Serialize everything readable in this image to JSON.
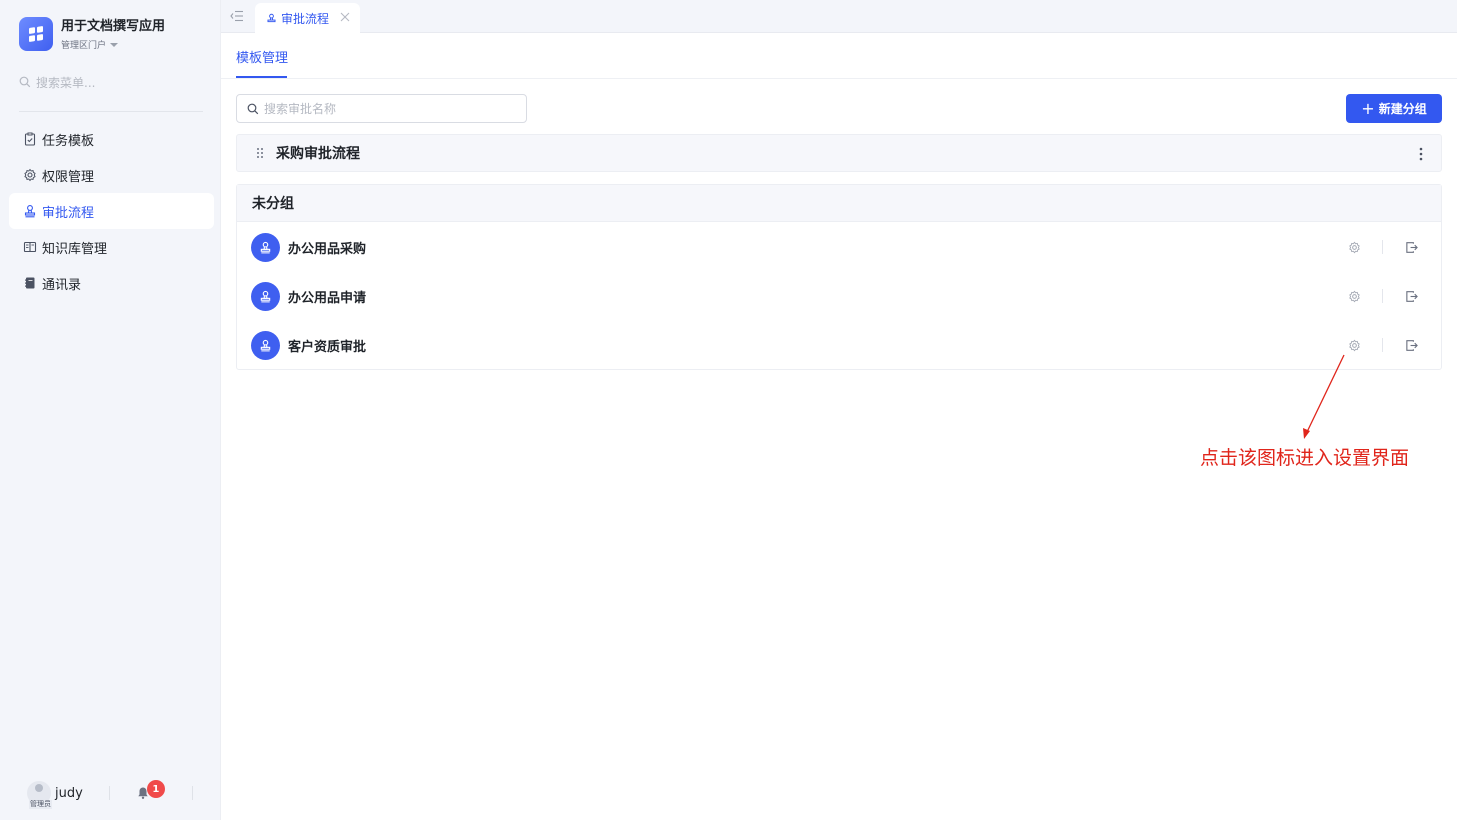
{
  "app": {
    "title": "用于文档撰写应用",
    "portal": "管理区门户"
  },
  "sidebar": {
    "search_placeholder": "搜索菜单...",
    "items": [
      {
        "label": "任务模板",
        "icon": "clipboard-check-icon"
      },
      {
        "label": "权限管理",
        "icon": "gear-icon"
      },
      {
        "label": "审批流程",
        "icon": "stamp-icon",
        "active": true
      },
      {
        "label": "知识库管理",
        "icon": "book-open-icon"
      },
      {
        "label": "通讯录",
        "icon": "contact-book-icon"
      }
    ]
  },
  "user": {
    "role_tag": "管理员",
    "name": "judy",
    "notification_count": "1"
  },
  "tabs": [
    {
      "label": "审批流程",
      "icon": "stamp-icon",
      "active": true
    }
  ],
  "subtabs": [
    {
      "label": "模板管理",
      "active": true
    }
  ],
  "toolbar": {
    "search_placeholder": "搜索审批名称",
    "new_group_label": "新建分组"
  },
  "groups": [
    {
      "name": "采购审批流程"
    }
  ],
  "ungrouped": {
    "title": "未分组",
    "items": [
      {
        "name": "办公用品采购"
      },
      {
        "name": "办公用品申请"
      },
      {
        "name": "客户资质审批"
      }
    ]
  },
  "annotation": {
    "text": "点击该图标进入设置界面",
    "color": "#e0251b"
  },
  "colors": {
    "accent": "#3358f0",
    "sidebar_bg": "#f3f5fa",
    "badge": "#f04a4a"
  }
}
